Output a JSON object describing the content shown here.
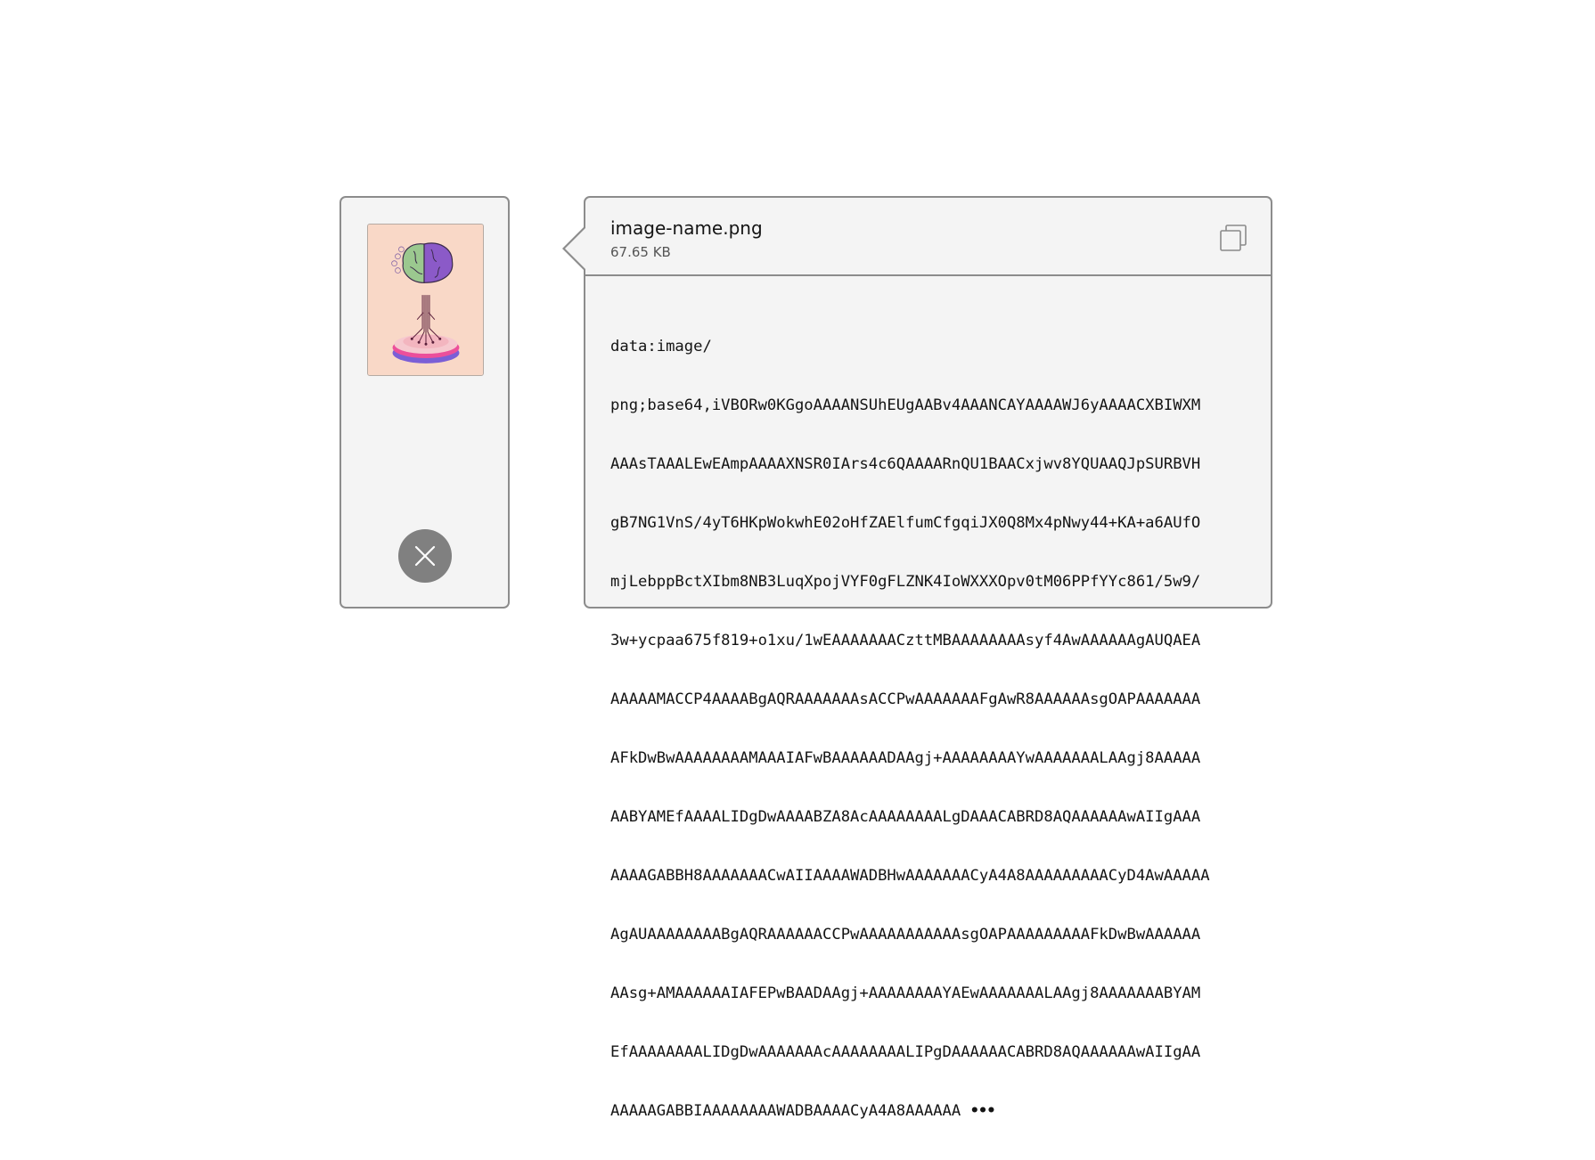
{
  "file": {
    "name": "image-name.png",
    "size": "67.65 KB"
  },
  "thumbnail": {
    "icon": "brain-tree-illustration",
    "background_color": "#f9d8c7"
  },
  "actions": {
    "remove_icon": "close-icon",
    "copy_icon": "copy-icon"
  },
  "data_uri_lines": [
    "data:image/",
    "png;base64,iVBORw0KGgoAAAANSUhEUgAABv4AAANCAYAAAAWJ6yAAAACXBIWXM",
    "AAAsTAAALEwEAmpAAAAXNSR0IArs4c6QAAAARnQU1BAACxjwv8YQUAAQJpSURBVH",
    "gB7NG1VnS/4yT6HKpWokwhE02oHfZAElfumCfgqiJX0Q8Mx4pNwy44+KA+a6AUfO",
    "mjLebppBctXIbm8NB3LuqXpojVYF0gFLZNK4IoWXXXOpv0tM06PPfYYc861/5w9/",
    "3w+ycpaa675f819+o1xu/1wEAAAAAAACzttMBAAAAAAAAsyf4AwAAAAAAgAUQAEA",
    "AAAAAMACCP4AAAABgAQRAAAAAAAsACCPwAAAAAAAFgAwR8AAAAAAsgOAPAAAAAAA",
    "AFkDwBwAAAAAAAAMAAAIAFwBAAAAAADAAgj+AAAAAAAAYwAAAAAAALAAgj8AAAAA",
    "AABYAMEfAAAALIDgDwAAAABZA8AcAAAAAAAALgDAAACABRD8AQAAAAAAwAIIgAAA",
    "AAAAGABBH8AAAAAAACwAIIAAAAWADBHwAAAAAAACyA4A8AAAAAAAAACyD4AwAAAAA",
    "AgAUAAAAAAAABgAQRAAAAAACCPwAAAAAAAAAAAsgOAPAAAAAAAAAFkDwBwAAAAAA",
    "AAsg+AMAAAAAAIAFEPwBAADAAgj+AAAAAAAAYAEwAAAAAAALAAgj8AAAAAAABYAM",
    "EfAAAAAAAALIDgDwAAAAAAAcAAAAAAAALIPgDAAAAAACABRD8AQAAAAAAwAIIgAA",
    "AAAAAGABBIAAAAAAAAWADBAAAACyA4A8AAAAAA"
  ],
  "ellipsis": "•••"
}
